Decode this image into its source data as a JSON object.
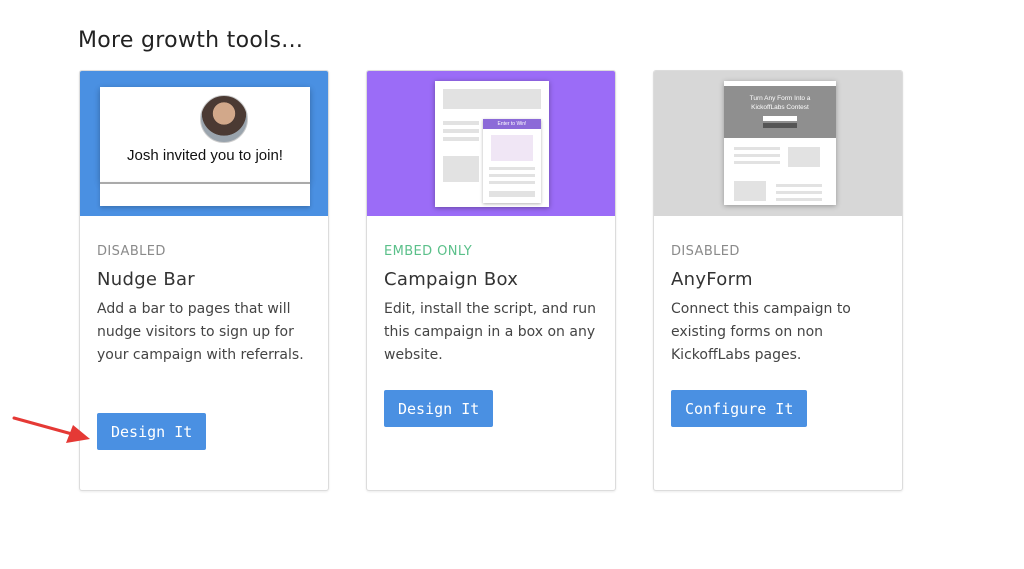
{
  "heading": "More growth tools...",
  "cards": [
    {
      "status": "DISABLED",
      "title": "Nudge Bar",
      "description": "Add a bar to pages that will nudge visitors to sign up for your campaign with referrals.",
      "button": "Design It",
      "thumbnail_text": "Josh invited you to join!",
      "thumb_color": "#4a90e2"
    },
    {
      "status": "EMBED ONLY",
      "title": "Campaign Box",
      "description": "Edit, install the script, and run this campaign in a box on any website.",
      "button": "Design It",
      "thumbnail_text": "Enter to Win!",
      "thumb_color": "#9b6cf7"
    },
    {
      "status": "DISABLED",
      "title": "AnyForm",
      "description": "Connect this campaign to existing forms on non KickoffLabs pages.",
      "button": "Configure It",
      "thumbnail_text": "Turn Any Form Into a KickoffLabs Contest",
      "thumb_color": "#d7d7d7"
    }
  ],
  "colors": {
    "button": "#4a90e2",
    "status_disabled": "#8a8a8a",
    "status_embed": "#5bc08a",
    "annotation_arrow": "#e53935"
  }
}
